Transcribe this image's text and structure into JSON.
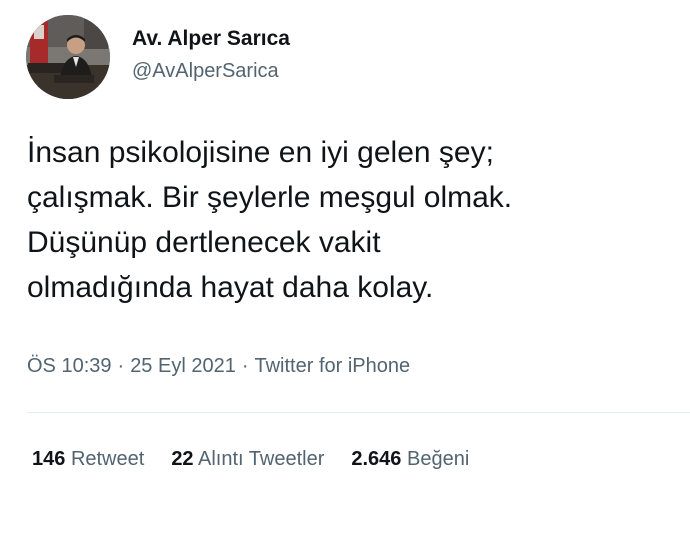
{
  "author": {
    "display_name": "Av. Alper Sarıca",
    "handle": "@AvAlperSarica"
  },
  "tweet": {
    "text": "İnsan psikolojisine en iyi gelen şey;\nçalışmak. Bir şeylerle meşgul olmak.\nDüşünüp dertlenecek vakit\nolmadığında hayat daha kolay.",
    "time": "ÖS 10:39",
    "separator": "·",
    "date": "25 Eyl 2021",
    "source": "Twitter for iPhone"
  },
  "stats": {
    "retweets": {
      "count": "146",
      "label": "Retweet"
    },
    "quotes": {
      "count": "22",
      "label": "Alıntı Tweetler"
    },
    "likes": {
      "count": "2.646",
      "label": "Beğeni"
    }
  },
  "colors": {
    "text_primary": "#0f1419",
    "text_secondary": "#536471",
    "divider": "#e7ecf0"
  }
}
